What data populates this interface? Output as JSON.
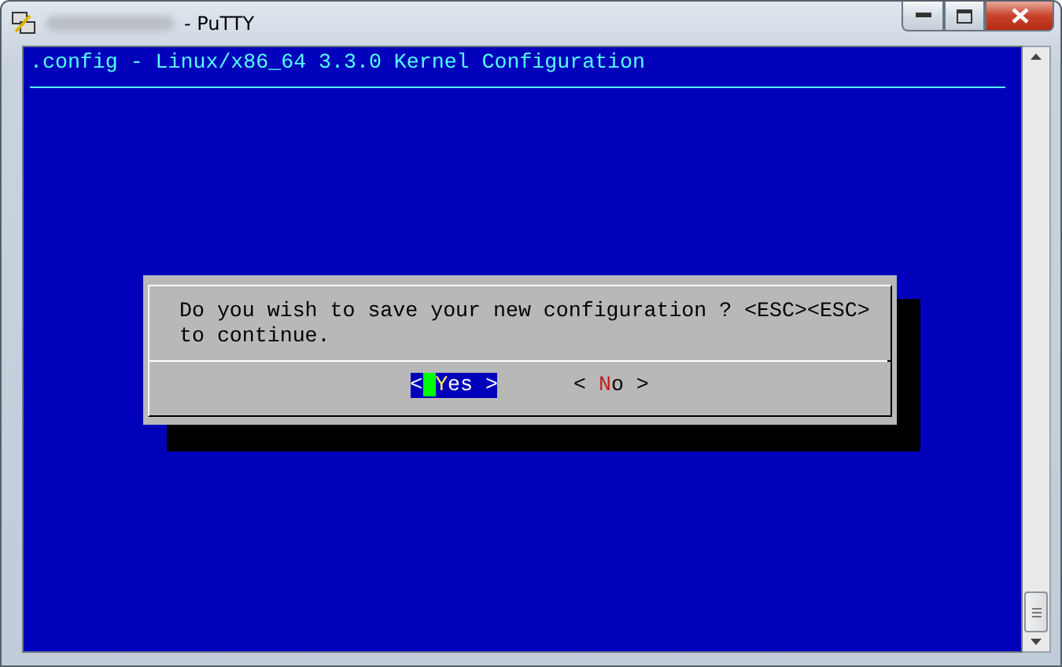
{
  "window": {
    "title": "- PuTTY"
  },
  "terminal": {
    "header": ".config - Linux/x86_64 3.3.0 Kernel Configuration"
  },
  "dialog": {
    "message": "Do you wish to save your new configuration ? <ESC><ESC> to continue.",
    "buttons": [
      {
        "open": "<",
        "hotkey": "Y",
        "label": "es",
        "close": ">",
        "selected": true
      },
      {
        "open": "<",
        "hotkey": "N",
        "label": "o",
        "close": ">",
        "selected": false
      }
    ]
  }
}
